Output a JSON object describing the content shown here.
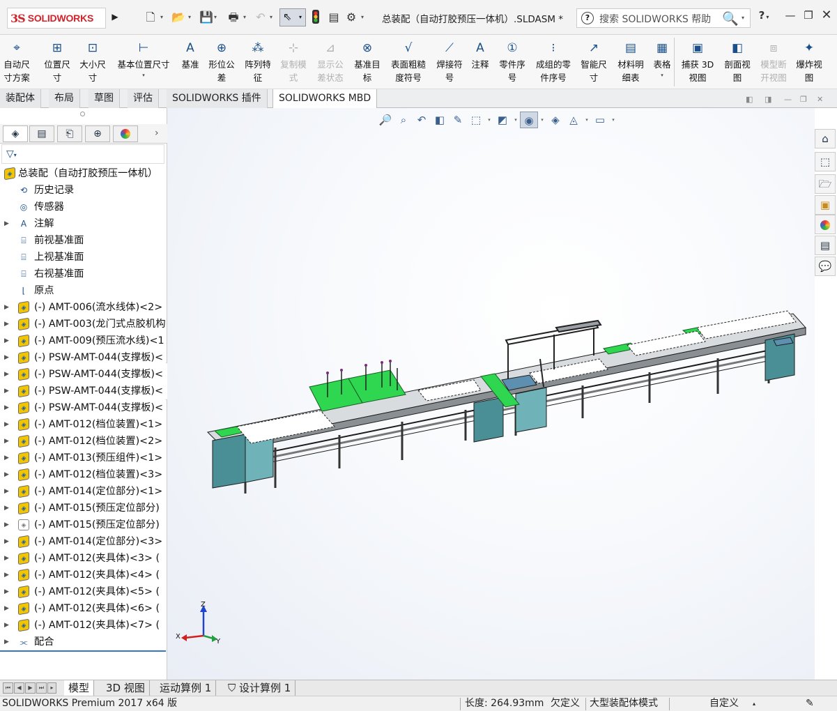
{
  "app": {
    "logo_ds": "3S",
    "logo_text": "SOLIDWORKS",
    "document_title": "总装配（自动打胶预压一体机）.SLDASM *",
    "help_placeholder": "搜索 SOLIDWORKS 帮助",
    "help_icon": "?",
    "window_help": "?"
  },
  "toolbar": [
    {
      "label": "自动尺\n寸方案",
      "icon": "⌖",
      "enabled": true
    },
    {
      "label": "位置尺\n寸",
      "icon": "⊞",
      "enabled": true
    },
    {
      "label": "大小尺\n寸",
      "icon": "⊡",
      "enabled": true
    },
    {
      "label": "基本位置尺寸",
      "icon": "⊢",
      "enabled": true
    },
    {
      "label": "基准",
      "icon": "A",
      "enabled": true
    },
    {
      "label": "形位公\n差",
      "icon": "⊕",
      "enabled": true
    },
    {
      "label": "阵列特\n征",
      "icon": "⁂",
      "enabled": true
    },
    {
      "label": "复制模\n式",
      "icon": "⊹",
      "enabled": false
    },
    {
      "label": "显示公\n差状态",
      "icon": "⊿",
      "enabled": false
    },
    {
      "label": "基准目\n标",
      "icon": "⊗",
      "enabled": true
    },
    {
      "label": "表面粗糙\n度符号",
      "icon": "√",
      "enabled": true
    },
    {
      "label": "焊接符\n号",
      "icon": "⟋",
      "enabled": true
    },
    {
      "label": "注释",
      "icon": "A",
      "enabled": true
    },
    {
      "label": "零件序\n号",
      "icon": "①",
      "enabled": true
    },
    {
      "label": "成组的零\n件序号",
      "icon": "⁝",
      "enabled": true
    },
    {
      "label": "智能尺\n寸",
      "icon": "↗",
      "enabled": true
    },
    {
      "label": "材料明\n细表",
      "icon": "▤",
      "enabled": true
    },
    {
      "label": "表格",
      "icon": "▦",
      "enabled": true
    },
    {
      "label": "捕获 3D\n视图",
      "icon": "▣",
      "enabled": true
    },
    {
      "label": "剖面视\n图",
      "icon": "◧",
      "enabled": true
    },
    {
      "label": "模型断\n开视图",
      "icon": "⧈",
      "enabled": false
    },
    {
      "label": "爆炸视\n图",
      "icon": "✦",
      "enabled": true
    }
  ],
  "cm_tabs": [
    "装配体",
    "布局",
    "草图",
    "评估",
    "SOLIDWORKS 插件",
    "SOLIDWORKS MBD"
  ],
  "cm_active_tab": "SOLIDWORKS MBD",
  "tree": {
    "root": "总装配（自动打胶预压一体机）",
    "items": [
      {
        "label": "历史记录",
        "icon": "history-icon",
        "expandable": false
      },
      {
        "label": "传感器",
        "icon": "sensor-icon",
        "expandable": false
      },
      {
        "label": "注解",
        "icon": "annotation-icon",
        "expandable": true
      },
      {
        "label": "前视基准面",
        "icon": "plane-icon",
        "expandable": false
      },
      {
        "label": "上视基准面",
        "icon": "plane-icon",
        "expandable": false
      },
      {
        "label": "右视基准面",
        "icon": "plane-icon",
        "expandable": false
      },
      {
        "label": "原点",
        "icon": "origin-icon",
        "expandable": false
      },
      {
        "label": "(-) AMT-006(流水线体)<2>",
        "icon": "part-icon",
        "expandable": true
      },
      {
        "label": "(-) AMT-003(龙门式点胶机构",
        "icon": "part-icon",
        "expandable": true
      },
      {
        "label": "(-) AMT-009(预压流水线)<1",
        "icon": "part-icon",
        "expandable": true
      },
      {
        "label": "(-) PSW-AMT-044(支撑板)<",
        "icon": "part-icon",
        "expandable": true
      },
      {
        "label": "(-) PSW-AMT-044(支撑板)<",
        "icon": "part-icon",
        "expandable": true
      },
      {
        "label": "(-) PSW-AMT-044(支撑板)<",
        "icon": "part-icon",
        "expandable": true
      },
      {
        "label": "(-) PSW-AMT-044(支撑板)<",
        "icon": "part-icon",
        "expandable": true
      },
      {
        "label": "(-) AMT-012(档位装置)<1>",
        "icon": "part-icon",
        "expandable": true
      },
      {
        "label": "(-) AMT-012(档位装置)<2>",
        "icon": "part-icon",
        "expandable": true
      },
      {
        "label": "(-) AMT-013(预压组件)<1>",
        "icon": "part-icon",
        "expandable": true
      },
      {
        "label": "(-) AMT-012(档位装置)<3>",
        "icon": "part-icon",
        "expandable": true
      },
      {
        "label": "(-) AMT-014(定位部分)<1>",
        "icon": "part-icon",
        "expandable": true
      },
      {
        "label": "(-) AMT-015(预压定位部分)",
        "icon": "part-icon",
        "expandable": true
      },
      {
        "label": "(-) AMT-015(预压定位部分)",
        "icon": "part-suppressed-icon",
        "expandable": true
      },
      {
        "label": "(-) AMT-014(定位部分)<3>",
        "icon": "part-icon",
        "expandable": true
      },
      {
        "label": "(-) AMT-012(夹具体)<3> (",
        "icon": "part-icon",
        "expandable": true
      },
      {
        "label": "(-) AMT-012(夹具体)<4> (",
        "icon": "part-icon",
        "expandable": true
      },
      {
        "label": "(-) AMT-012(夹具体)<5> (",
        "icon": "part-icon",
        "expandable": true
      },
      {
        "label": "(-) AMT-012(夹具体)<6> (",
        "icon": "part-icon",
        "expandable": true
      },
      {
        "label": "(-) AMT-012(夹具体)<7> (",
        "icon": "part-icon",
        "expandable": true
      },
      {
        "label": "配合",
        "icon": "mates-icon",
        "expandable": true
      }
    ]
  },
  "triad": {
    "x": "X",
    "y": "Y",
    "z": "Z"
  },
  "bottom_tabs": [
    "模型",
    "3D 视图",
    "运动算例 1",
    "设计算例 1"
  ],
  "bottom_active_tab": "模型",
  "status": {
    "product": "SOLIDWORKS Premium 2017 x64 版",
    "length": "长度: 264.93mm",
    "defined": "欠定义",
    "mode": "大型装配体模式",
    "units": "自定义"
  },
  "colors": {
    "brand": "#d2232a",
    "accent": "#3478c4",
    "machine_green": "#2fd650",
    "panel_teal": "#4a8f95"
  }
}
